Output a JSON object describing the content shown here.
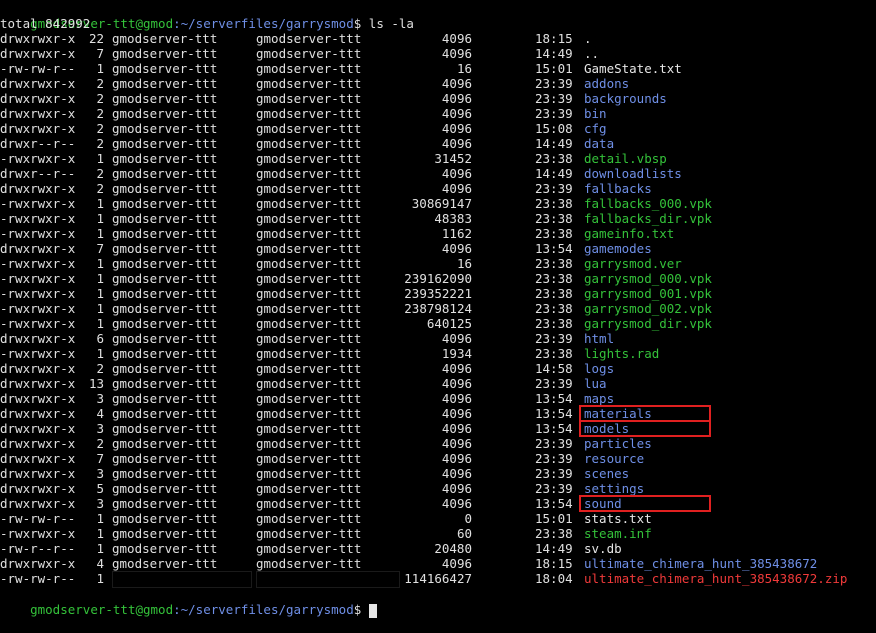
{
  "prompt_top": {
    "user_host": "gmodserver-ttt@gmod",
    "path": ":~/serverfiles/garrysmod",
    "suffix": "$ ",
    "command": "ls -la"
  },
  "total_line": "total 842992",
  "rows": [
    {
      "perm": "drwxrwxr-x",
      "links": "22",
      "owner": "gmodserver-ttt",
      "group": "gmodserver-ttt",
      "size": "4096",
      "time": "18:15",
      "name": ".",
      "type": "plain"
    },
    {
      "perm": "drwxrwxr-x",
      "links": "7",
      "owner": "gmodserver-ttt",
      "group": "gmodserver-ttt",
      "size": "4096",
      "time": "14:49",
      "name": "..",
      "type": "plain"
    },
    {
      "perm": "-rw-rw-r--",
      "links": "1",
      "owner": "gmodserver-ttt",
      "group": "gmodserver-ttt",
      "size": "16",
      "time": "15:01",
      "name": "GameState.txt",
      "type": "plain"
    },
    {
      "perm": "drwxrwxr-x",
      "links": "2",
      "owner": "gmodserver-ttt",
      "group": "gmodserver-ttt",
      "size": "4096",
      "time": "23:39",
      "name": "addons",
      "type": "dir"
    },
    {
      "perm": "drwxrwxr-x",
      "links": "2",
      "owner": "gmodserver-ttt",
      "group": "gmodserver-ttt",
      "size": "4096",
      "time": "23:39",
      "name": "backgrounds",
      "type": "dir"
    },
    {
      "perm": "drwxrwxr-x",
      "links": "2",
      "owner": "gmodserver-ttt",
      "group": "gmodserver-ttt",
      "size": "4096",
      "time": "23:39",
      "name": "bin",
      "type": "dir"
    },
    {
      "perm": "drwxrwxr-x",
      "links": "2",
      "owner": "gmodserver-ttt",
      "group": "gmodserver-ttt",
      "size": "4096",
      "time": "15:08",
      "name": "cfg",
      "type": "dir"
    },
    {
      "perm": "drwxr--r--",
      "links": "2",
      "owner": "gmodserver-ttt",
      "group": "gmodserver-ttt",
      "size": "4096",
      "time": "14:49",
      "name": "data",
      "type": "dir"
    },
    {
      "perm": "-rwxrwxr-x",
      "links": "1",
      "owner": "gmodserver-ttt",
      "group": "gmodserver-ttt",
      "size": "31452",
      "time": "23:38",
      "name": "detail.vbsp",
      "type": "exec"
    },
    {
      "perm": "drwxr--r--",
      "links": "2",
      "owner": "gmodserver-ttt",
      "group": "gmodserver-ttt",
      "size": "4096",
      "time": "14:49",
      "name": "downloadlists",
      "type": "dir"
    },
    {
      "perm": "drwxrwxr-x",
      "links": "2",
      "owner": "gmodserver-ttt",
      "group": "gmodserver-ttt",
      "size": "4096",
      "time": "23:39",
      "name": "fallbacks",
      "type": "dir"
    },
    {
      "perm": "-rwxrwxr-x",
      "links": "1",
      "owner": "gmodserver-ttt",
      "group": "gmodserver-ttt",
      "size": "30869147",
      "time": "23:38",
      "name": "fallbacks_000.vpk",
      "type": "exec"
    },
    {
      "perm": "-rwxrwxr-x",
      "links": "1",
      "owner": "gmodserver-ttt",
      "group": "gmodserver-ttt",
      "size": "48383",
      "time": "23:38",
      "name": "fallbacks_dir.vpk",
      "type": "exec"
    },
    {
      "perm": "-rwxrwxr-x",
      "links": "1",
      "owner": "gmodserver-ttt",
      "group": "gmodserver-ttt",
      "size": "1162",
      "time": "23:38",
      "name": "gameinfo.txt",
      "type": "exec"
    },
    {
      "perm": "drwxrwxr-x",
      "links": "7",
      "owner": "gmodserver-ttt",
      "group": "gmodserver-ttt",
      "size": "4096",
      "time": "13:54",
      "name": "gamemodes",
      "type": "dir"
    },
    {
      "perm": "-rwxrwxr-x",
      "links": "1",
      "owner": "gmodserver-ttt",
      "group": "gmodserver-ttt",
      "size": "16",
      "time": "23:38",
      "name": "garrysmod.ver",
      "type": "exec"
    },
    {
      "perm": "-rwxrwxr-x",
      "links": "1",
      "owner": "gmodserver-ttt",
      "group": "gmodserver-ttt",
      "size": "239162090",
      "time": "23:38",
      "name": "garrysmod_000.vpk",
      "type": "exec"
    },
    {
      "perm": "-rwxrwxr-x",
      "links": "1",
      "owner": "gmodserver-ttt",
      "group": "gmodserver-ttt",
      "size": "239352221",
      "time": "23:38",
      "name": "garrysmod_001.vpk",
      "type": "exec"
    },
    {
      "perm": "-rwxrwxr-x",
      "links": "1",
      "owner": "gmodserver-ttt",
      "group": "gmodserver-ttt",
      "size": "238798124",
      "time": "23:38",
      "name": "garrysmod_002.vpk",
      "type": "exec"
    },
    {
      "perm": "-rwxrwxr-x",
      "links": "1",
      "owner": "gmodserver-ttt",
      "group": "gmodserver-ttt",
      "size": "640125",
      "time": "23:38",
      "name": "garrysmod_dir.vpk",
      "type": "exec"
    },
    {
      "perm": "drwxrwxr-x",
      "links": "6",
      "owner": "gmodserver-ttt",
      "group": "gmodserver-ttt",
      "size": "4096",
      "time": "23:39",
      "name": "html",
      "type": "dir"
    },
    {
      "perm": "-rwxrwxr-x",
      "links": "1",
      "owner": "gmodserver-ttt",
      "group": "gmodserver-ttt",
      "size": "1934",
      "time": "23:38",
      "name": "lights.rad",
      "type": "exec"
    },
    {
      "perm": "drwxrwxr-x",
      "links": "2",
      "owner": "gmodserver-ttt",
      "group": "gmodserver-ttt",
      "size": "4096",
      "time": "14:58",
      "name": "logs",
      "type": "dir"
    },
    {
      "perm": "drwxrwxr-x",
      "links": "13",
      "owner": "gmodserver-ttt",
      "group": "gmodserver-ttt",
      "size": "4096",
      "time": "23:39",
      "name": "lua",
      "type": "dir"
    },
    {
      "perm": "drwxrwxr-x",
      "links": "3",
      "owner": "gmodserver-ttt",
      "group": "gmodserver-ttt",
      "size": "4096",
      "time": "13:54",
      "name": "maps",
      "type": "dir"
    },
    {
      "perm": "drwxrwxr-x",
      "links": "4",
      "owner": "gmodserver-ttt",
      "group": "gmodserver-ttt",
      "size": "4096",
      "time": "13:54",
      "name": "materials",
      "type": "dir"
    },
    {
      "perm": "drwxrwxr-x",
      "links": "3",
      "owner": "gmodserver-ttt",
      "group": "gmodserver-ttt",
      "size": "4096",
      "time": "13:54",
      "name": "models",
      "type": "dir"
    },
    {
      "perm": "drwxrwxr-x",
      "links": "2",
      "owner": "gmodserver-ttt",
      "group": "gmodserver-ttt",
      "size": "4096",
      "time": "23:39",
      "name": "particles",
      "type": "dir"
    },
    {
      "perm": "drwxrwxr-x",
      "links": "7",
      "owner": "gmodserver-ttt",
      "group": "gmodserver-ttt",
      "size": "4096",
      "time": "23:39",
      "name": "resource",
      "type": "dir"
    },
    {
      "perm": "drwxrwxr-x",
      "links": "3",
      "owner": "gmodserver-ttt",
      "group": "gmodserver-ttt",
      "size": "4096",
      "time": "23:39",
      "name": "scenes",
      "type": "dir"
    },
    {
      "perm": "drwxrwxr-x",
      "links": "5",
      "owner": "gmodserver-ttt",
      "group": "gmodserver-ttt",
      "size": "4096",
      "time": "23:39",
      "name": "settings",
      "type": "dir"
    },
    {
      "perm": "drwxrwxr-x",
      "links": "3",
      "owner": "gmodserver-ttt",
      "group": "gmodserver-ttt",
      "size": "4096",
      "time": "13:54",
      "name": "sound",
      "type": "dir"
    },
    {
      "perm": "-rw-rw-r--",
      "links": "1",
      "owner": "gmodserver-ttt",
      "group": "gmodserver-ttt",
      "size": "0",
      "time": "15:01",
      "name": "stats.txt",
      "type": "plain"
    },
    {
      "perm": "-rwxrwxr-x",
      "links": "1",
      "owner": "gmodserver-ttt",
      "group": "gmodserver-ttt",
      "size": "60",
      "time": "23:38",
      "name": "steam.inf",
      "type": "exec"
    },
    {
      "perm": "-rw-r--r--",
      "links": "1",
      "owner": "gmodserver-ttt",
      "group": "gmodserver-ttt",
      "size": "20480",
      "time": "14:49",
      "name": "sv.db",
      "type": "plain"
    },
    {
      "perm": "drwxrwxr-x",
      "links": "4",
      "owner": "gmodserver-ttt",
      "group": "gmodserver-ttt",
      "size": "4096",
      "time": "18:15",
      "name": "ultimate_chimera_hunt_385438672",
      "type": "dir"
    },
    {
      "perm": "-rw-rw-r--",
      "links": "1",
      "owner": "",
      "group": "",
      "size": "114166427",
      "time": "18:04",
      "name": "ultimate_chimera_hunt_385438672.zip",
      "type": "archive",
      "redacted_owner": true
    }
  ],
  "prompt_bottom": {
    "user_host": "gmodserver-ttt@gmod",
    "path": ":~/serverfiles/garrysmod",
    "suffix": "$ "
  },
  "highlighted_names": [
    "materials",
    "models",
    "sound"
  ],
  "colors": {
    "background": "#000000",
    "text": "#e0e0e0",
    "directory": "#6f8fe6",
    "executable": "#34c23a",
    "archive": "#f03a3a",
    "highlight_box": "#e02020"
  }
}
